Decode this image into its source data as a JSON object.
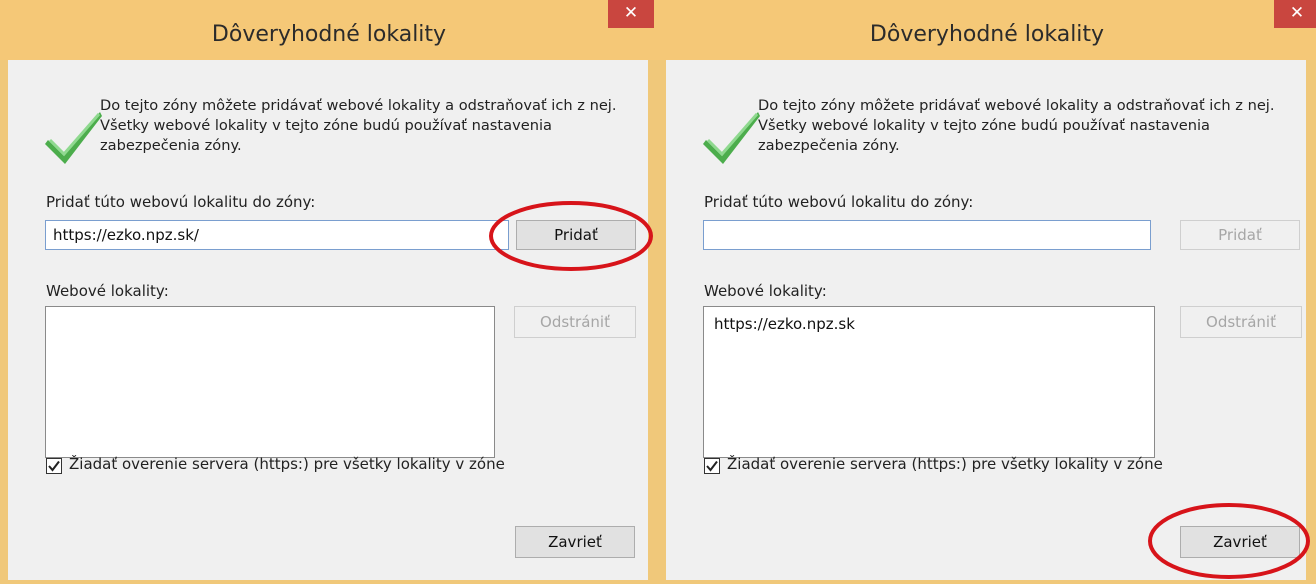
{
  "dialogs": [
    {
      "title": "Dôveryhodné lokality",
      "close_glyph": "✕",
      "description": "Do tejto zóny môžete pridávať webové lokality a odstraňovať ich z nej. Všetky webové lokality v tejto zóne budú používať nastavenia zabezpečenia zóny.",
      "add_label": "Pridať túto webovú lokalitu do zóny:",
      "add_input_value": "https://ezko.npz.sk/",
      "add_button": "Pridať",
      "add_button_enabled": true,
      "sites_label": "Webové lokality:",
      "sites": [],
      "remove_button": "Odstrániť",
      "remove_button_enabled": false,
      "require_https_label": "Žiadať overenie servera (https:) pre všetky lokality v zóne",
      "require_https_checked": true,
      "close_button": "Zavrieť",
      "highlighted": "add-button"
    },
    {
      "title": "Dôveryhodné lokality",
      "close_glyph": "✕",
      "description": "Do tejto zóny môžete pridávať webové lokality a odstraňovať ich z nej. Všetky webové lokality v tejto zóne budú používať nastavenia zabezpečenia zóny.",
      "add_label": "Pridať túto webovú lokalitu do zóny:",
      "add_input_value": "",
      "add_button": "Pridať",
      "add_button_enabled": false,
      "sites_label": "Webové lokality:",
      "sites": [
        "https://ezko.npz.sk"
      ],
      "remove_button": "Odstrániť",
      "remove_button_enabled": false,
      "require_https_label": "Žiadať overenie servera (https:) pre všetky lokality v zóne",
      "require_https_checked": true,
      "close_button": "Zavrieť",
      "highlighted": "close-button"
    }
  ],
  "colors": {
    "titlebar": "#f5c877",
    "close_red": "#c9463f",
    "client_bg": "#f0f0f0",
    "annotation": "#d7141a",
    "check_green": "#5cb85c"
  },
  "icons": {
    "dialog_icon": "green-checkmark-icon",
    "checkbox_mark": "checkmark-icon",
    "close": "close-icon"
  }
}
